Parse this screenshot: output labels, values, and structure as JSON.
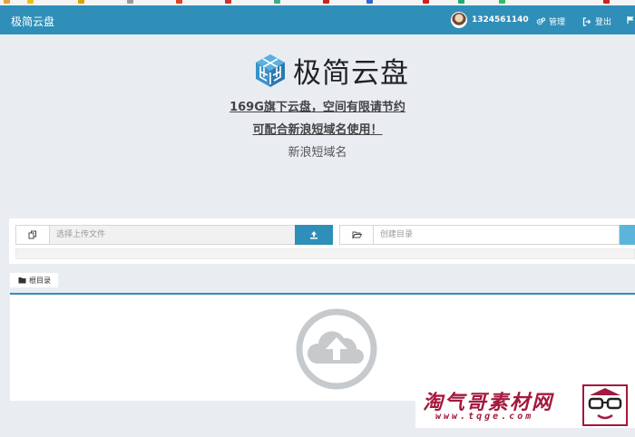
{
  "colors": {
    "primary": "#2f8fb8",
    "accent_light": "#5bb5da",
    "watermark": "#a4193d",
    "page_bg": "#e9edf2"
  },
  "navbar": {
    "brand": "极简云盘",
    "user": "1324561140",
    "manage_label": "管理",
    "logout_label": "登出",
    "icons": [
      "avatar",
      "gears-icon",
      "sign-out-icon",
      "flag-icon"
    ]
  },
  "hero": {
    "title": "极简云盘",
    "logo_icon": "cube-logo-icon",
    "tagline1": "169G旗下云盘，空间有限请节约",
    "tagline2": "可配合新浪短域名使用！",
    "tagline3": "新浪短域名"
  },
  "upload": {
    "file_placeholder": "选择上传文件",
    "dir_placeholder": "创建目录",
    "icons": [
      "copy-icon",
      "upload-icon",
      "folder-open-icon"
    ]
  },
  "breadcrumb": {
    "root_label": "根目录",
    "icon": "folder-icon"
  },
  "dropzone": {
    "icon": "cloud-upload-icon"
  },
  "watermark": {
    "title": "淘气哥素材网",
    "url": "www.tqge.com"
  }
}
